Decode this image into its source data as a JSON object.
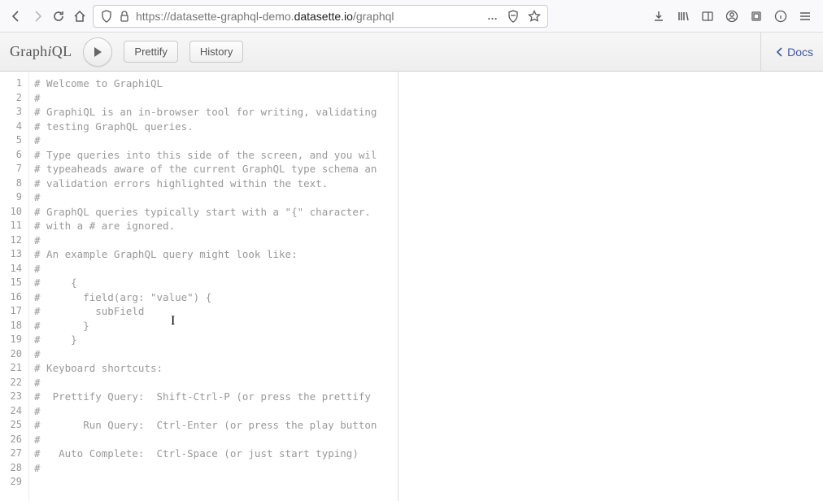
{
  "browser": {
    "url_prefix": "https://datasette-graphql-demo.",
    "url_domain": "datasette.io",
    "url_path": "/graphql",
    "ellipsis": "…"
  },
  "toolbar": {
    "logo_prefix": "Graph",
    "logo_i": "i",
    "logo_suffix": "QL",
    "prettify": "Prettify",
    "history": "History",
    "docs": "Docs"
  },
  "editor": {
    "lines": [
      "# Welcome to GraphiQL",
      "#",
      "# GraphiQL is an in-browser tool for writing, validating",
      "# testing GraphQL queries.",
      "#",
      "# Type queries into this side of the screen, and you wil",
      "# typeaheads aware of the current GraphQL type schema an",
      "# validation errors highlighted within the text.",
      "#",
      "# GraphQL queries typically start with a \"{\" character.",
      "# with a # are ignored.",
      "#",
      "# An example GraphQL query might look like:",
      "#",
      "#     {",
      "#       field(arg: \"value\") {",
      "#         subField",
      "#       }",
      "#     }",
      "#",
      "# Keyboard shortcuts:",
      "#",
      "#  Prettify Query:  Shift-Ctrl-P (or press the prettify",
      "#",
      "#       Run Query:  Ctrl-Enter (or press the play button",
      "#",
      "#   Auto Complete:  Ctrl-Space (or just start typing)",
      "#",
      ""
    ]
  }
}
